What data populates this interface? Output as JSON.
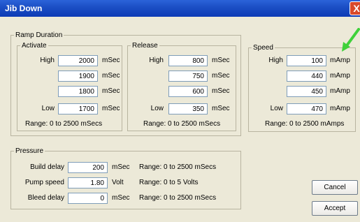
{
  "window": {
    "title": "Jib Down",
    "close_label": "X"
  },
  "ramp_duration": {
    "legend": "Ramp Duration",
    "activate": {
      "legend": "Activate",
      "high_label": "High",
      "low_label": "Low",
      "values": [
        "2000",
        "1900",
        "1800",
        "1700"
      ],
      "unit": "mSec",
      "range": "Range: 0 to 2500 mSecs"
    },
    "release": {
      "legend": "Release",
      "high_label": "High",
      "low_label": "Low",
      "values": [
        "800",
        "750",
        "600",
        "350"
      ],
      "unit": "mSec",
      "range": "Range: 0 to 2500 mSecs"
    }
  },
  "speed": {
    "legend": "Speed",
    "high_label": "High",
    "low_label": "Low",
    "values": [
      "100",
      "440",
      "450",
      "470"
    ],
    "unit": "mAmp",
    "range": "Range: 0 to 2500 mAmps"
  },
  "pressure": {
    "legend": "Pressure",
    "build_delay": {
      "label": "Build delay",
      "value": "200",
      "unit": "mSec",
      "range": "Range: 0 to 2500 mSecs"
    },
    "pump_speed": {
      "label": "Pump speed",
      "value": "1.80",
      "unit": "Volt",
      "range": "Range: 0 to 5 Volts"
    },
    "bleed_delay": {
      "label": "Bleed delay",
      "value": "0",
      "unit": "mSec",
      "range": "Range: 0 to 2500 mSecs"
    }
  },
  "buttons": {
    "cancel": "Cancel",
    "accept": "Accept"
  },
  "annotation": {
    "icon": "green-arrow-icon",
    "color": "#3fd13a"
  }
}
